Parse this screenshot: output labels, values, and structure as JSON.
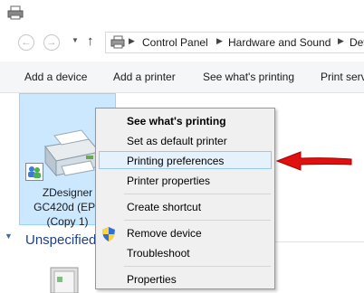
{
  "breadcrumb": {
    "items": [
      "Control Panel",
      "Hardware and Sound",
      "Dev"
    ]
  },
  "commandbar": {
    "add_device": "Add a device",
    "add_printer": "Add a printer",
    "see_printing": "See what's printing",
    "print_server": "Print serv"
  },
  "device": {
    "name_line1": "ZDesigner",
    "name_line2": "GC420d (EPL",
    "name_line3": "(Copy 1)"
  },
  "section": {
    "unspecified": "Unspecified"
  },
  "context_menu": {
    "items": [
      "See what's printing",
      "Set as default printer",
      "Printing preferences",
      "Printer properties",
      "Create shortcut",
      "Remove device",
      "Troubleshoot",
      "Properties"
    ],
    "highlighted": "Printing preferences"
  },
  "colors": {
    "selection_fill": "#cce8ff",
    "menu_highlight": "#e5f1fb",
    "arrow": "#e01010",
    "section_header": "#1e3f87"
  },
  "icons": [
    "printer-title-icon",
    "back-icon",
    "forward-icon",
    "up-icon",
    "devices-printers-icon",
    "printer-icon",
    "users-overlay-icon",
    "uac-shield-icon",
    "device-icon",
    "red-arrow"
  ]
}
